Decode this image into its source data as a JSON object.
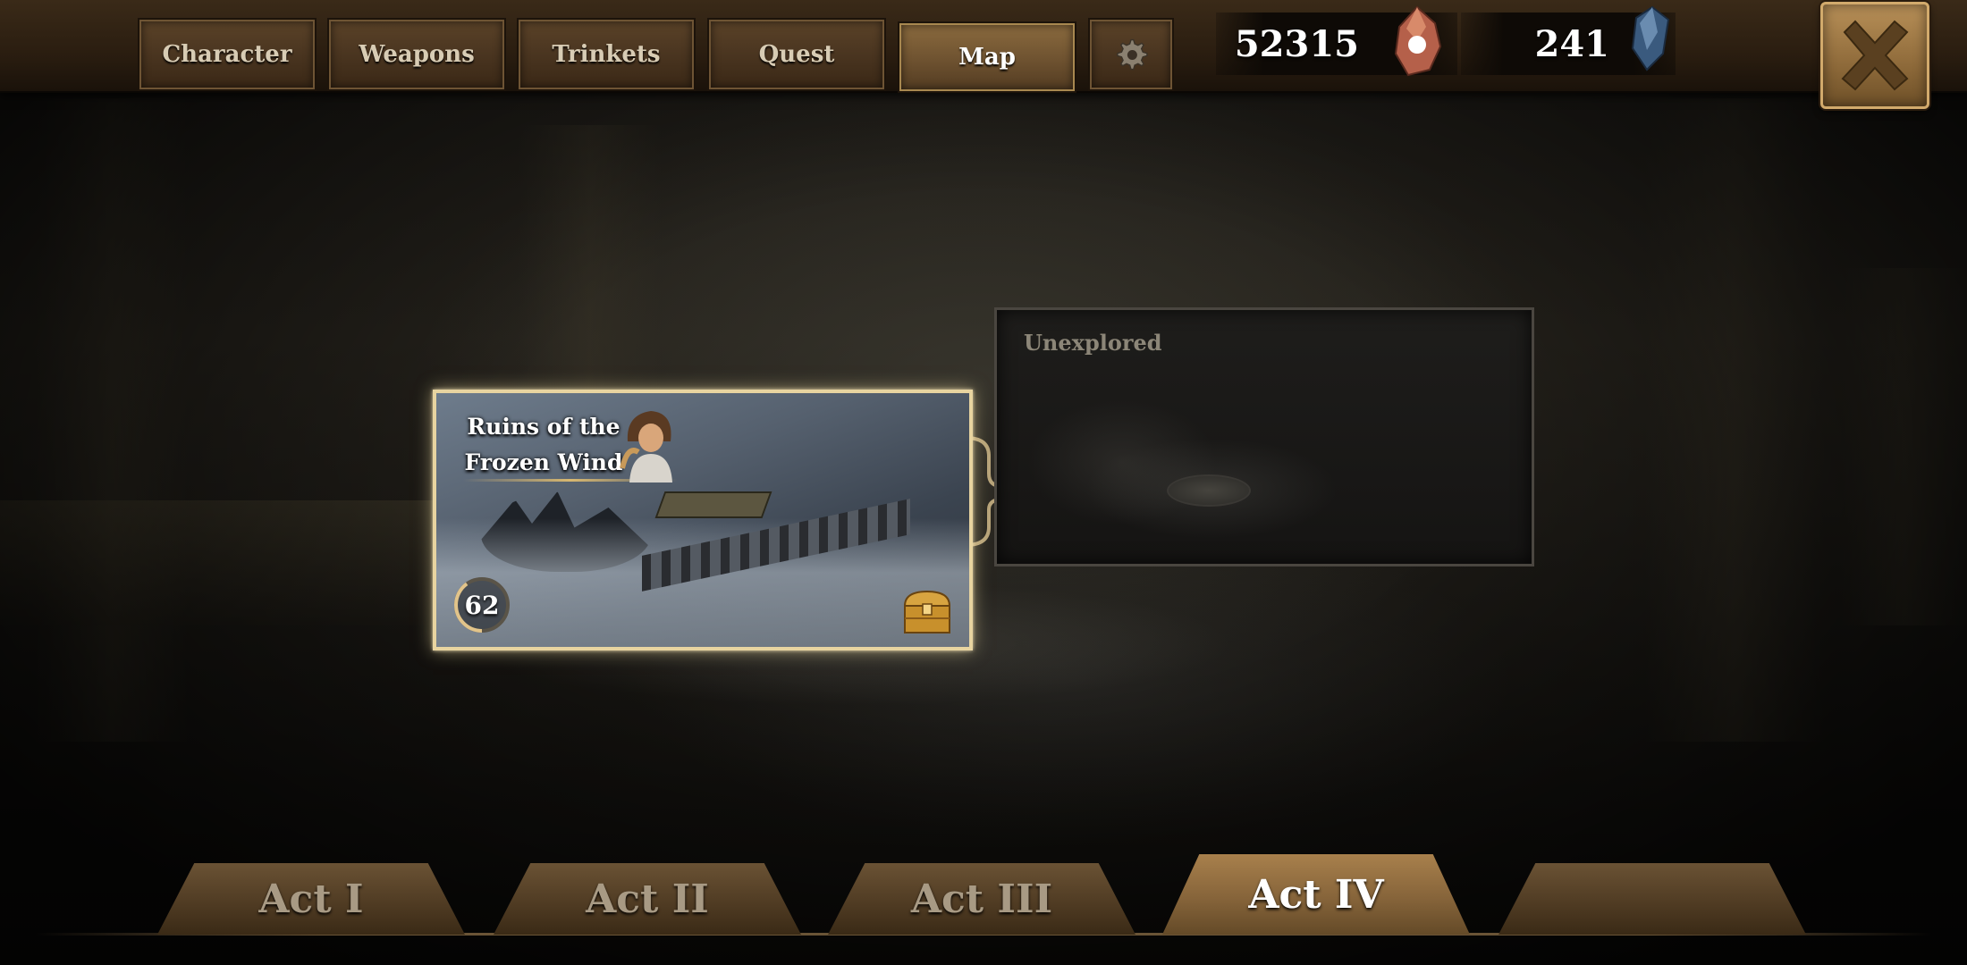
{
  "nav": {
    "tabs": [
      {
        "label": "Character"
      },
      {
        "label": "Weapons"
      },
      {
        "label": "Trinkets"
      },
      {
        "label": "Quest"
      },
      {
        "label": "Map",
        "active": true
      }
    ],
    "settings_icon": "gear-icon",
    "close_icon": "close-x-icon"
  },
  "currencies": {
    "gold": {
      "value": "52315",
      "icon": "ore-gem-icon"
    },
    "crystals": {
      "value": "241",
      "icon": "blue-crystal-icon"
    }
  },
  "map": {
    "current_level": {
      "title_line1": "Ruins of the",
      "title_line2": "Frozen Wind",
      "level": "62",
      "level_progress_percent": 40,
      "reward_icon": "treasure-chest-icon",
      "portrait_icon": "hero-portrait-icon"
    },
    "next_level": {
      "label": "Unexplored"
    }
  },
  "acts": {
    "tabs": [
      {
        "label": "Act I"
      },
      {
        "label": "Act II"
      },
      {
        "label": "Act III"
      },
      {
        "label": "Act IV",
        "active": true
      },
      {
        "label": ""
      }
    ]
  },
  "colors": {
    "accent_gold": "#e8d4a0",
    "panel_brown": "#4a3520",
    "active_tab": "#8a6a3e"
  }
}
